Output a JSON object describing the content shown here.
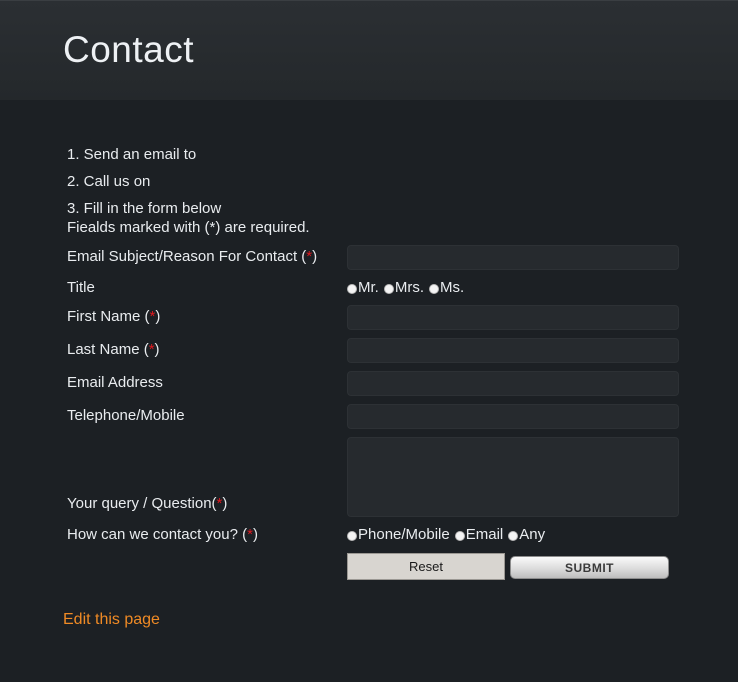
{
  "header": {
    "title": "Contact"
  },
  "intro": {
    "step1": "1. Send an email to",
    "step2": "2. Call us on",
    "step3": "3. Fill in the form below",
    "required_note": "Fiealds marked with (*) are required."
  },
  "form": {
    "subject_label": "Email Subject/Reason For Contact (",
    "title_label": "Title",
    "title_options": [
      "Mr.",
      "Mrs.",
      "Ms."
    ],
    "first_name_label": "First Name (",
    "last_name_label": "Last Name (",
    "email_label": "Email Address",
    "phone_label": "Telephone/Mobile",
    "query_label": "Your query / Question(",
    "contact_label": "How can we contact you? (",
    "contact_options": [
      "Phone/Mobile",
      "Email",
      "Any"
    ],
    "required_star": "*",
    "close_paren": ")",
    "reset_label": "Reset",
    "submit_label": "SUBMIT"
  },
  "footer": {
    "edit_link": "Edit this page"
  },
  "colors": {
    "background": "#1c2024",
    "required": "#e0181e",
    "link": "#ef8a25"
  }
}
